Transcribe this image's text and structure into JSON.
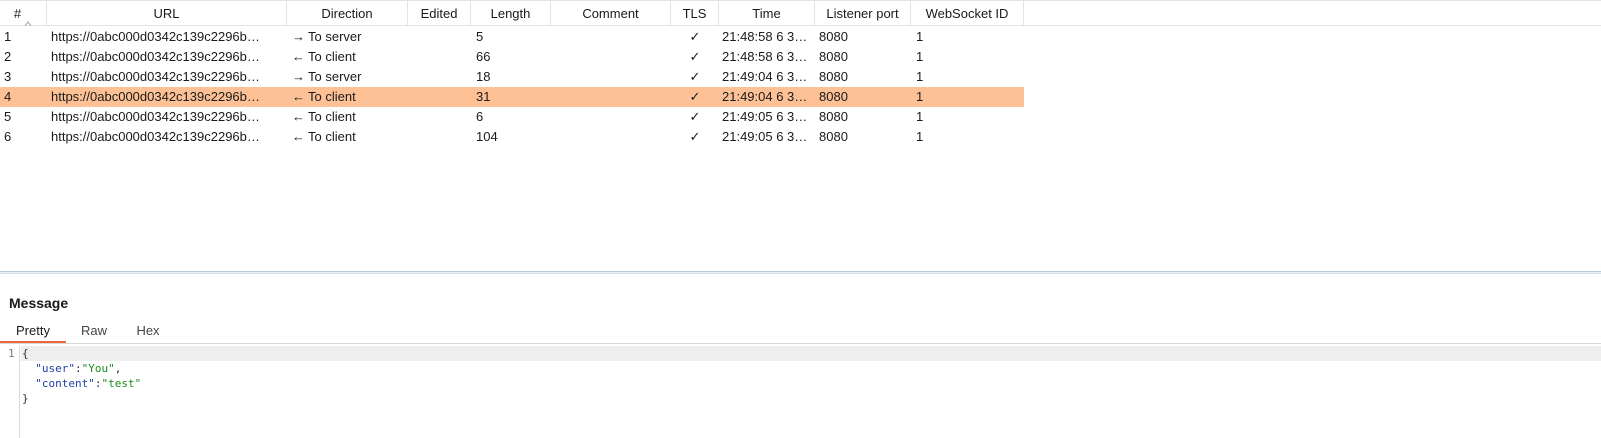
{
  "table": {
    "columns": {
      "num": "#",
      "url": "URL",
      "direction": "Direction",
      "edited": "Edited",
      "length": "Length",
      "comment": "Comment",
      "tls": "TLS",
      "time": "Time",
      "listener_port": "Listener port",
      "websocket_id": "WebSocket ID"
    },
    "sort_icon": "sort-ascending-icon",
    "selected_row": 4,
    "selected_color": "#fdc195",
    "rows": [
      {
        "num": "1",
        "url": "https://0abc000d0342c139c2296b…",
        "arrow": "→",
        "direction": "To server",
        "edited": "",
        "length": "5",
        "comment": "",
        "tls": "✓",
        "time": "21:48:58 6 3…",
        "port": "8080",
        "ws_id": "1"
      },
      {
        "num": "2",
        "url": "https://0abc000d0342c139c2296b…",
        "arrow": "←",
        "direction": "To client",
        "edited": "",
        "length": "66",
        "comment": "",
        "tls": "✓",
        "time": "21:48:58 6 3…",
        "port": "8080",
        "ws_id": "1"
      },
      {
        "num": "3",
        "url": "https://0abc000d0342c139c2296b…",
        "arrow": "→",
        "direction": "To server",
        "edited": "",
        "length": "18",
        "comment": "",
        "tls": "✓",
        "time": "21:49:04 6 3…",
        "port": "8080",
        "ws_id": "1"
      },
      {
        "num": "4",
        "url": "https://0abc000d0342c139c2296b…",
        "arrow": "←",
        "direction": "To client",
        "edited": "",
        "length": "31",
        "comment": "",
        "tls": "✓",
        "time": "21:49:04 6 3…",
        "port": "8080",
        "ws_id": "1"
      },
      {
        "num": "5",
        "url": "https://0abc000d0342c139c2296b…",
        "arrow": "←",
        "direction": "To client",
        "edited": "",
        "length": "6",
        "comment": "",
        "tls": "✓",
        "time": "21:49:05 6 3…",
        "port": "8080",
        "ws_id": "1"
      },
      {
        "num": "6",
        "url": "https://0abc000d0342c139c2296b…",
        "arrow": "←",
        "direction": "To client",
        "edited": "",
        "length": "104",
        "comment": "",
        "tls": "✓",
        "time": "21:49:05 6 3…",
        "port": "8080",
        "ws_id": "1"
      }
    ]
  },
  "message": {
    "title": "Message",
    "tabs": [
      "Pretty",
      "Raw",
      "Hex"
    ],
    "active_tab": "Pretty",
    "accent": "#e8683a",
    "editor": {
      "line_number": "1",
      "open_brace": "{",
      "user_key": "\"user\"",
      "user_value": "\"You\"",
      "content_key": "\"content\"",
      "content_value": "\"test\"",
      "close_brace": "}",
      "colon": ":",
      "comma": ","
    }
  }
}
